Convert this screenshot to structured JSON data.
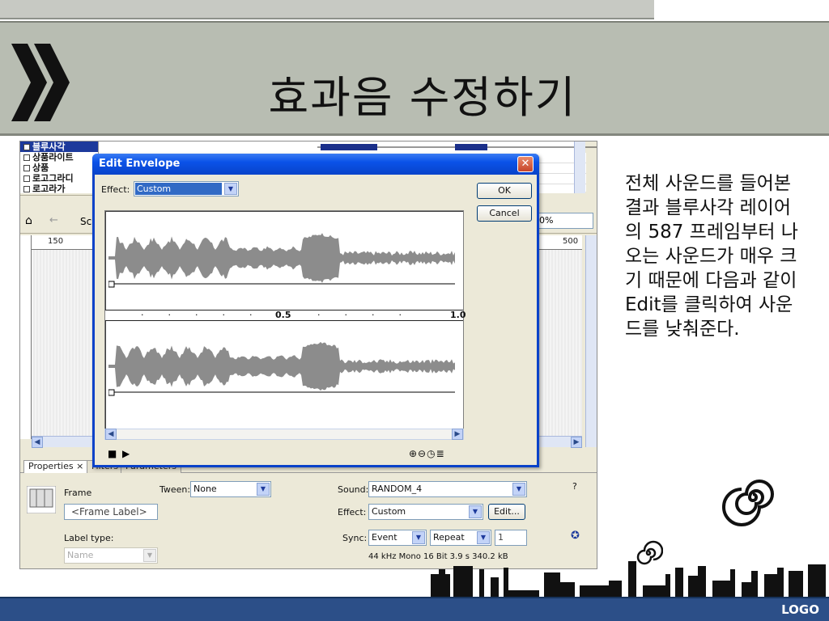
{
  "slide": {
    "title": "효과음 수정하기",
    "description": "전체 사운드를 들어본 결과 블루사각 레이어의 587 프레임부터 나오는 사운드가 매우 크기 때문에 다음과 같이 Edit를 클릭하여 사운드를 낮춰준다.",
    "logo": "LOGO"
  },
  "ide": {
    "layers": [
      "블루사각",
      "상품라이트",
      "상품",
      "로고그라디",
      "로고라가"
    ],
    "toolbar_text": "Sc",
    "zoom": "0%",
    "ruler_labels": [
      "150",
      "500"
    ],
    "properties": {
      "tabs": [
        "Properties",
        "Filters",
        "Parameters"
      ],
      "frame_label": "Frame",
      "frame_label_placeholder": "<Frame Label>",
      "tween_label": "Tween:",
      "tween_value": "None",
      "label_type_label": "Label type:",
      "label_type_value": "Name",
      "sound_label": "Sound:",
      "sound_value": "RANDOM_4",
      "effect_label": "Effect:",
      "effect_value": "Custom",
      "edit_button": "Edit...",
      "sync_label": "Sync:",
      "sync_value": "Event",
      "repeat_value": "Repeat",
      "repeat_count": "1",
      "sound_info": "44 kHz Mono 16 Bit 3.9 s 340.2 kB"
    }
  },
  "dialog": {
    "title": "Edit Envelope",
    "effect_label": "Effect:",
    "effect_value": "Custom",
    "ok": "OK",
    "cancel": "Cancel",
    "time_markers": [
      "0.5",
      "1.0"
    ]
  },
  "colors": {
    "title_bar": "#b8bdb2",
    "bottom_bar": "#2c4f88",
    "dialog_title": "#0a52e8",
    "waveform": "#8c8c8c"
  }
}
